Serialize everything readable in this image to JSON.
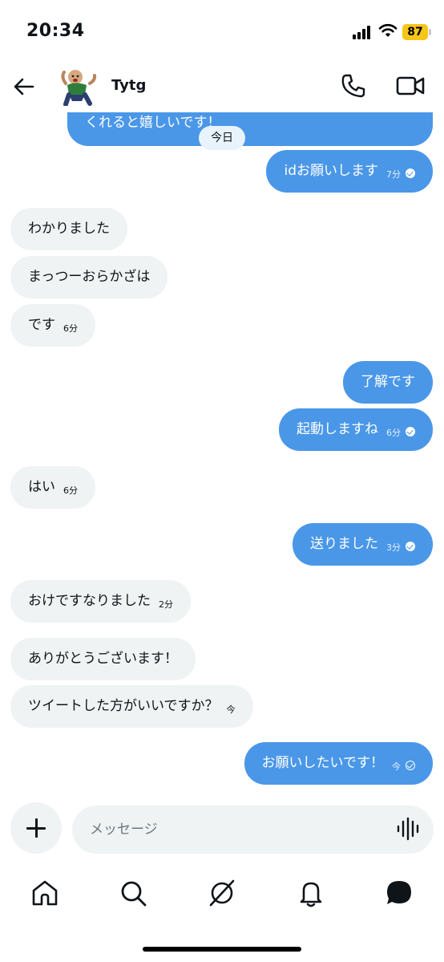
{
  "status_bar": {
    "time": "20:34",
    "battery": "87",
    "battery_color": "#f5c518"
  },
  "header": {
    "contact_name": "Tytg",
    "back_icon": "arrow-left-icon",
    "call_icon": "phone-icon",
    "video_icon": "video-camera-icon"
  },
  "conversation": {
    "previous_message": "くれると嬉しいです！",
    "day_separator": "今日",
    "messages": [
      {
        "direction": "out",
        "text": "idお願いします",
        "time": "7分",
        "status": "read"
      },
      {
        "direction": "in",
        "text": "わかりました",
        "time": ""
      },
      {
        "direction": "in",
        "text": "まっつーおらかざは",
        "time": ""
      },
      {
        "direction": "in",
        "text": "です",
        "time": "6分"
      },
      {
        "direction": "out",
        "text": "了解です",
        "time": "",
        "status": ""
      },
      {
        "direction": "out",
        "text": "起動しますね",
        "time": "6分",
        "status": "read"
      },
      {
        "direction": "in",
        "text": "はい",
        "time": "6分"
      },
      {
        "direction": "out",
        "text": "送りました",
        "time": "3分",
        "status": "read"
      },
      {
        "direction": "in",
        "text": "おけですなりました",
        "time": "2分"
      },
      {
        "direction": "in",
        "text": "ありがとうございます！",
        "time": ""
      },
      {
        "direction": "in",
        "text": "ツイートした方がいいですか？",
        "time": "今"
      },
      {
        "direction": "out",
        "text": "お願いしたいです！",
        "time": "今",
        "status": "sent"
      }
    ]
  },
  "composer": {
    "placeholder": "メッセージ",
    "add_icon": "plus-icon",
    "voice_icon": "voice-wave-icon"
  },
  "tabs": [
    {
      "name": "home",
      "icon": "home-icon"
    },
    {
      "name": "search",
      "icon": "search-icon"
    },
    {
      "name": "grok",
      "icon": "grok-icon"
    },
    {
      "name": "notifications",
      "icon": "bell-icon"
    },
    {
      "name": "messages",
      "icon": "message-bubble-icon",
      "active": true
    }
  ],
  "colors": {
    "accent": "#4a97e8",
    "incoming_bubble": "#eff3f4",
    "text": "#0f1419"
  }
}
